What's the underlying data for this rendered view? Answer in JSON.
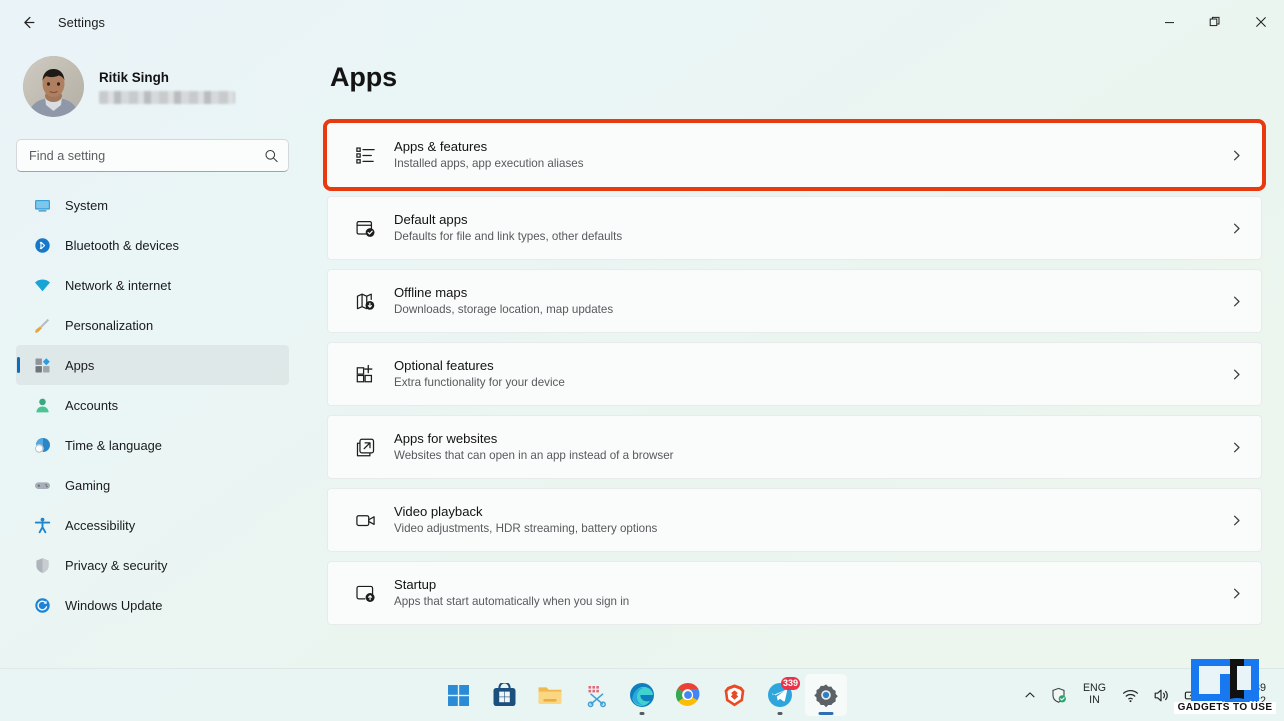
{
  "window": {
    "title": "Settings",
    "back_icon": "back-arrow-icon",
    "minimize_label": "Minimize",
    "maximize_label": "Restore",
    "close_label": "Close"
  },
  "sidebar": {
    "profile": {
      "name": "Ritik Singh",
      "email_redacted": "",
      "avatar_alt": "user-avatar"
    },
    "search": {
      "placeholder": "Find a setting",
      "value": "",
      "icon": "search-icon"
    },
    "items": [
      {
        "label": "System",
        "icon": "monitor-icon",
        "active": false
      },
      {
        "label": "Bluetooth & devices",
        "icon": "bluetooth-icon",
        "active": false
      },
      {
        "label": "Network & internet",
        "icon": "wifi-icon",
        "active": false
      },
      {
        "label": "Personalization",
        "icon": "paintbrush-icon",
        "active": false
      },
      {
        "label": "Apps",
        "icon": "apps-grid-icon",
        "active": true
      },
      {
        "label": "Accounts",
        "icon": "person-icon",
        "active": false
      },
      {
        "label": "Time & language",
        "icon": "clock-globe-icon",
        "active": false
      },
      {
        "label": "Gaming",
        "icon": "gamepad-icon",
        "active": false
      },
      {
        "label": "Accessibility",
        "icon": "accessibility-icon",
        "active": false
      },
      {
        "label": "Privacy & security",
        "icon": "shield-icon",
        "active": false
      },
      {
        "label": "Windows Update",
        "icon": "update-refresh-icon",
        "active": false
      }
    ]
  },
  "main": {
    "page_title": "Apps",
    "highlight_color": "#e8390f",
    "cards": [
      {
        "title": "Apps & features",
        "subtitle": "Installed apps, app execution aliases",
        "icon": "list-settings-icon",
        "chevron": "chevron-right-icon",
        "highlighted": true
      },
      {
        "title": "Default apps",
        "subtitle": "Defaults for file and link types, other defaults",
        "icon": "window-check-icon",
        "chevron": "chevron-right-icon",
        "highlighted": false
      },
      {
        "title": "Offline maps",
        "subtitle": "Downloads, storage location, map updates",
        "icon": "map-download-icon",
        "chevron": "chevron-right-icon",
        "highlighted": false
      },
      {
        "title": "Optional features",
        "subtitle": "Extra functionality for your device",
        "icon": "grid-plus-icon",
        "chevron": "chevron-right-icon",
        "highlighted": false
      },
      {
        "title": "Apps for websites",
        "subtitle": "Websites that can open in an app instead of a browser",
        "icon": "external-link-icon",
        "chevron": "chevron-right-icon",
        "highlighted": false
      },
      {
        "title": "Video playback",
        "subtitle": "Video adjustments, HDR streaming, battery options",
        "icon": "video-camera-icon",
        "chevron": "chevron-right-icon",
        "highlighted": false
      },
      {
        "title": "Startup",
        "subtitle": "Apps that start automatically when you sign in",
        "icon": "startup-power-icon",
        "chevron": "chevron-right-icon",
        "highlighted": false
      }
    ]
  },
  "taskbar": {
    "buttons": [
      {
        "name": "start-button",
        "icon": "windows-start-icon",
        "state": "idle",
        "badge": ""
      },
      {
        "name": "microsoft-store",
        "icon": "store-bag-icon",
        "state": "idle",
        "badge": ""
      },
      {
        "name": "file-explorer",
        "icon": "folder-icon",
        "state": "idle",
        "badge": ""
      },
      {
        "name": "snipping-tool",
        "icon": "scissors-icon",
        "state": "idle",
        "badge": ""
      },
      {
        "name": "microsoft-edge",
        "icon": "edge-icon",
        "state": "running",
        "badge": ""
      },
      {
        "name": "google-chrome",
        "icon": "chrome-icon",
        "state": "idle",
        "badge": ""
      },
      {
        "name": "brave-browser",
        "icon": "brave-lion-icon",
        "state": "idle",
        "badge": ""
      },
      {
        "name": "telegram",
        "icon": "telegram-icon",
        "state": "running",
        "badge": "339"
      },
      {
        "name": "settings",
        "icon": "gear-icon",
        "state": "active",
        "badge": ""
      }
    ],
    "tray": {
      "overflow_icon": "chevron-up-icon",
      "security_icon": "security-shield-icon",
      "language_top": "ENG",
      "language_bottom": "IN",
      "wifi_icon": "wifi-icon",
      "volume_icon": "speaker-icon",
      "battery_icon": "battery-charging-icon",
      "clock_time": "16:39",
      "clock_date": "3/26/2022"
    }
  },
  "watermark": {
    "text": "GADGETS TO USE",
    "logo": "gtu-logo-icon"
  }
}
